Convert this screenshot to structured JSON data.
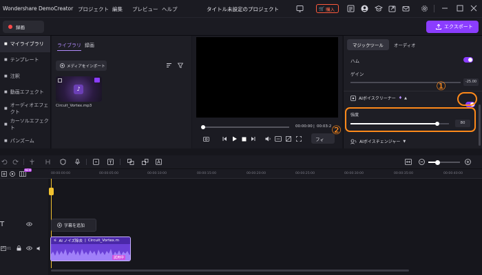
{
  "app": {
    "name": "Wondershare DemoCreator",
    "project_title": "タイトル未設定のプロジェクト",
    "menus": [
      "プロジェクト",
      "編集",
      "プレビュー",
      "ヘルプ"
    ],
    "buy_label": "購入"
  },
  "toolbar": {
    "record_label": "録画",
    "export_label": "エクスポート"
  },
  "sidebar": {
    "items": [
      {
        "label": "マイライブラリ"
      },
      {
        "label": "テンプレート"
      },
      {
        "label": "注釈"
      },
      {
        "label": "動画エフェクト"
      },
      {
        "label": "オーディオエフェクト"
      },
      {
        "label": "カーソルエフェクト"
      },
      {
        "label": "パンズーム"
      }
    ]
  },
  "library": {
    "tabs": [
      "ライブラリ",
      "録画"
    ],
    "import_label": "メディアをインポート",
    "media_name": "Circuit_Vortex.mp3"
  },
  "preview": {
    "time_current": "00:00:00",
    "time_total": "00:03:2",
    "fit_label": "フィ"
  },
  "rightpanel": {
    "tabs": [
      "マジックツール",
      "オーディオ"
    ],
    "hum_label": "ハム",
    "gain_label": "ゲイン",
    "gain_value": "-25.00",
    "ai_voice_cleaner_label": "AIボイスクリーナー",
    "strength_label": "強度",
    "strength_value": "80",
    "strength_level": 0.88,
    "ai_voice_changer_label": "AIボイスチェンジャー"
  },
  "callouts": {
    "one": "①",
    "two": "②"
  },
  "timeline": {
    "ticks": [
      "00:00:00:00",
      "00:00:05:00",
      "00:00:10:00",
      "00:00:15:00",
      "00:00:20:00",
      "00:00:25:00",
      "00:00:30:00",
      "00:00:35:00",
      "00:00:40:00"
    ],
    "add_caption_label": "字幕を追加",
    "clip_label": "AI ノイズ除去",
    "clip_file": "Circuit_Vortex.m",
    "clip_badge": "試用中",
    "track_num": "01",
    "new_badge": "NEW"
  },
  "colors": {
    "accent": "#8b3dff",
    "annotation": "#ff8a1a",
    "clip": "#6a3fd6"
  }
}
